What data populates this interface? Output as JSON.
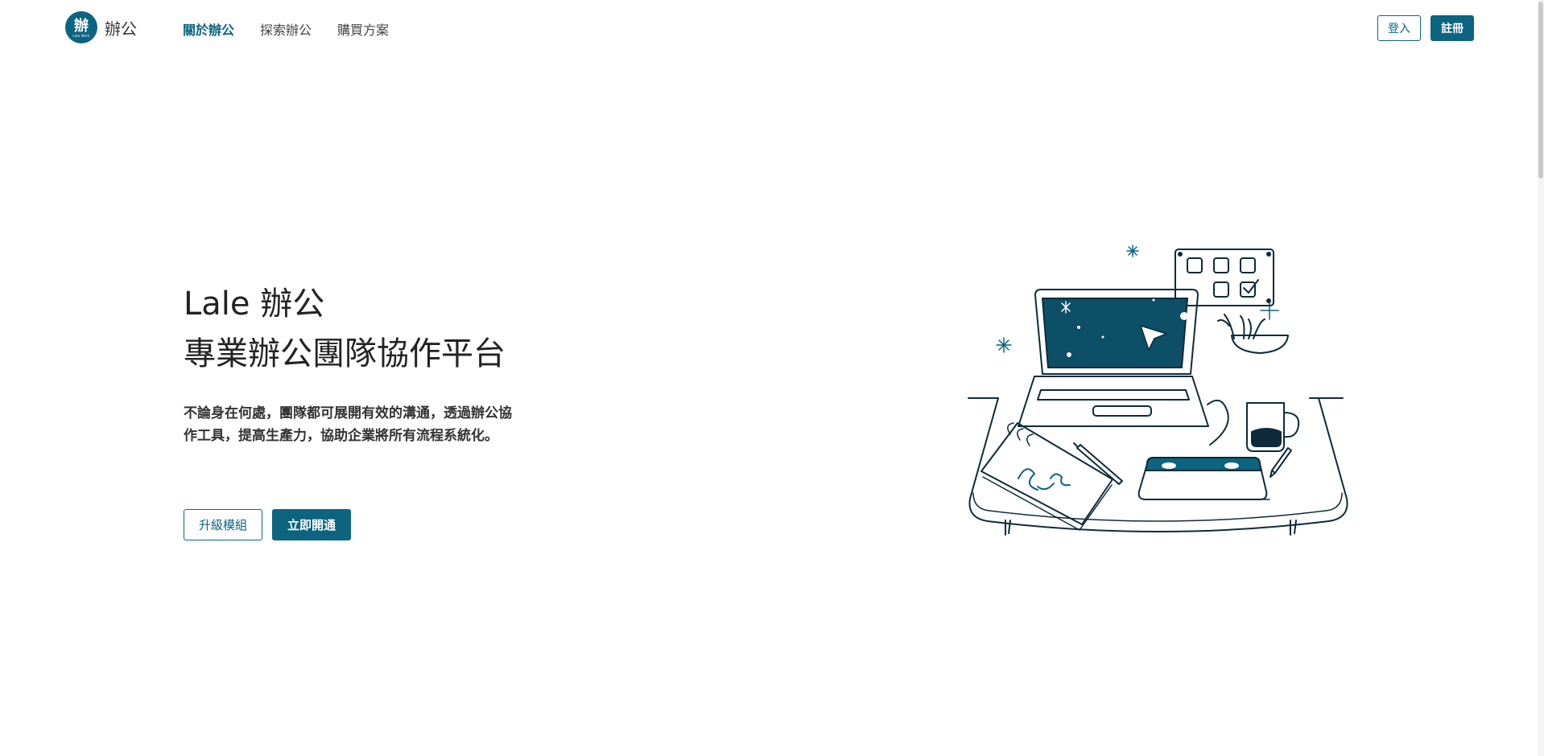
{
  "brand": {
    "logo_char": "辦",
    "logo_sub": "Lale Work",
    "name": "辦公"
  },
  "nav": {
    "items": [
      "關於辦公",
      "探索辦公",
      "購買方案"
    ],
    "active_index": 0
  },
  "auth": {
    "login_label": "登入",
    "signup_label": "註冊"
  },
  "hero": {
    "title_line1": "Lale 辦公",
    "title_line2": "專業辦公團隊協作平台",
    "description": "不論身在何處，團隊都可展開有效的溝通，透過辦公協作工具，提高生產力，協助企業將所有流程系統化。",
    "upgrade_label": "升級模組",
    "open_label": "立即開通"
  },
  "theme": {
    "accent": "#0c6480",
    "ink": "#0d2b3a"
  }
}
